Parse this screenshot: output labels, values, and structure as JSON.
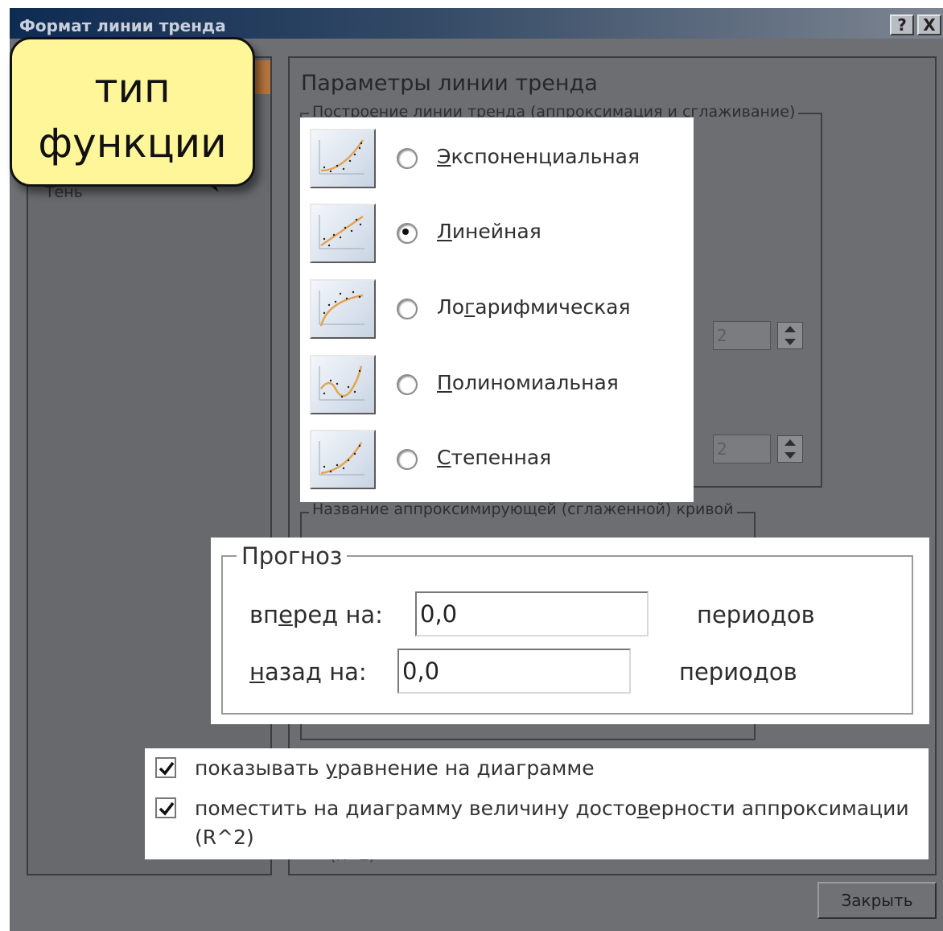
{
  "window": {
    "title": "Формат линии тренда",
    "help_label": "?",
    "close_label": "X"
  },
  "left_panel": {
    "partial_item": "Тень"
  },
  "right_panel": {
    "section_title": "Параметры линии тренда",
    "group_trend_label": "Построение линии тренда (аппроксимация и сглаживание)",
    "polynomial_degree_value": "2",
    "moving_average_period_value": "2",
    "group_name_label": "Название аппроксимирующей (сглаженной) кривой",
    "r2_ghost": "(R^2)",
    "close_button_label": "Закрыть"
  },
  "trend_types": {
    "selected": "linear",
    "items": [
      {
        "id": "exponential",
        "label": "Экспоненциальная",
        "underline_index": 0,
        "selected": false,
        "icon": "exponential-trend-icon"
      },
      {
        "id": "linear",
        "label": "Линейная",
        "underline_index": 0,
        "selected": true,
        "icon": "linear-trend-icon"
      },
      {
        "id": "logarithmic",
        "label": "Логарифмическая",
        "underline_index": 2,
        "selected": false,
        "icon": "logarithmic-trend-icon"
      },
      {
        "id": "polynomial",
        "label": "Полиномиальная",
        "underline_index": 0,
        "selected": false,
        "icon": "polynomial-trend-icon"
      },
      {
        "id": "power",
        "label": "Степенная",
        "underline_index": 0,
        "selected": false,
        "icon": "power-trend-icon"
      }
    ]
  },
  "forecast": {
    "title": "Прогноз",
    "forward_label": "вперед на:",
    "forward_value": "0,0",
    "backward_label": "назад на:",
    "backward_value": "0,0",
    "units": "периодов"
  },
  "options": {
    "show_equation": {
      "label": "показывать уравнение на диаграмме",
      "checked": true
    },
    "show_r2": {
      "label_line1": "поместить на диаграмму величину достоверности аппроксимации",
      "label_line2": "(R^2)",
      "checked": true
    }
  },
  "callout": {
    "line1": "тип",
    "line2": "функции"
  }
}
